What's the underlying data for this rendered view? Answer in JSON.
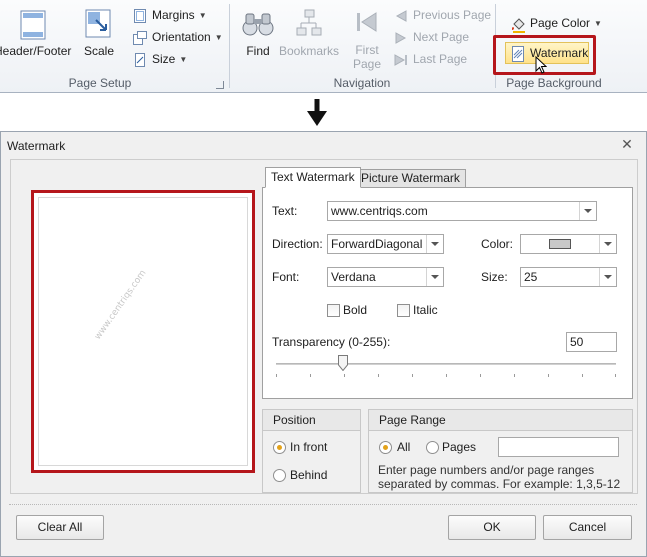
{
  "ribbon": {
    "page_setup": {
      "header_footer_label": "Header/Footer",
      "scale_label": "Scale",
      "margins_label": "Margins",
      "orientation_label": "Orientation",
      "size_label": "Size",
      "group_label": "Page Setup"
    },
    "navigation": {
      "find_label": "Find",
      "bookmarks_label": "Bookmarks",
      "first_page_line1": "First",
      "first_page_line2": "Page",
      "previous_page_label": "Previous Page",
      "next_page_label": "Next Page",
      "last_page_label": "Last Page",
      "group_label": "Navigation"
    },
    "page_background": {
      "page_color_label": "Page Color",
      "watermark_label": "Watermark",
      "group_label": "Page Background"
    }
  },
  "dialog": {
    "title": "Watermark",
    "preview": {
      "watermark_text": "www.centriqs.com"
    },
    "tabs": [
      "Text Watermark",
      "Picture Watermark"
    ],
    "text_tab": {
      "text_label": "Text:",
      "text_value": "www.centriqs.com",
      "direction_label": "Direction:",
      "direction_value": "ForwardDiagonal",
      "color_label": "Color:",
      "color_value": "#c8c8c8",
      "font_label": "Font:",
      "font_value": "Verdana",
      "size_label": "Size:",
      "size_value": "25",
      "bold_label": "Bold",
      "bold_checked": false,
      "italic_label": "Italic",
      "italic_checked": false,
      "transparency_label": "Transparency (0-255):",
      "transparency_value": "50"
    },
    "position": {
      "header": "Position",
      "in_front_label": "In front",
      "in_front_selected": true,
      "behind_label": "Behind",
      "behind_selected": false
    },
    "page_range": {
      "header": "Page Range",
      "all_label": "All",
      "all_selected": true,
      "pages_label": "Pages",
      "pages_value": "",
      "hint": "Enter page numbers and/or page ranges separated by commas. For example: 1,3,5-12"
    },
    "buttons": {
      "clear_all": "Clear All",
      "ok": "OK",
      "cancel": "Cancel"
    }
  },
  "colors": {
    "highlight_border": "#b5161b",
    "radio_selected": "#e3a21a",
    "watermark_button_bg": "#ffe28a"
  },
  "icons": {
    "header_footer": "header-footer-icon",
    "scale": "scale-icon",
    "margins": "margins-icon",
    "orientation": "orientation-icon",
    "size": "size-icon",
    "find": "binoculars-icon",
    "bookmarks": "bookmarks-tree-icon",
    "first_page": "first-page-icon",
    "previous_page": "previous-page-icon",
    "next_page": "next-page-icon",
    "last_page": "last-page-icon",
    "page_color": "paint-bucket-icon",
    "watermark": "watermark-icon",
    "cursor": "mouse-pointer-icon",
    "arrow": "down-arrow-icon",
    "close": "close-icon"
  }
}
